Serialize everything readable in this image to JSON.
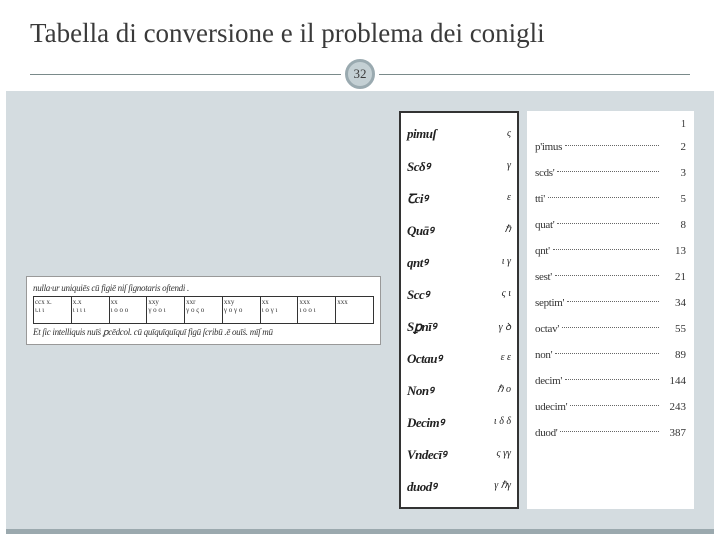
{
  "title": "Tabella di conversione e il problema dei conigli",
  "page_number": "32",
  "manuscript_table": {
    "top_text": "nulla·ur uniquiēs cū figiē niſ ſignotaris oſtendi .",
    "bottom_text": "Et ſic intelliquis nuīṡ ꝑcēdcol. cū quīquīquīquī figū ſcribū .ē ouīṡ. mīſ mū",
    "cells_top": [
      "ccx x.",
      "x.x",
      "xx",
      "xxy",
      "xxr",
      "xxy",
      "xx",
      "xxx",
      "xxx"
    ],
    "cells_bottom": [
      "ι.ι ι",
      "ι ι ι ι",
      "ι o o o",
      "γ ο ο ι",
      "γ ο ς ο",
      "γ ο γ ο",
      "ι ο γ ι",
      "ι ο ο ι"
    ]
  },
  "chart_data": {
    "type": "table",
    "title": "Fibonacci rabbit problem sequence",
    "columns": [
      "ordinal_manuscript",
      "ordinal_printed",
      "value"
    ],
    "rows": [
      {
        "ordinal_manuscript": "pimuſ",
        "ordinal_printed": "p'imus",
        "value": 2,
        "manu_num": "ς"
      },
      {
        "ordinal_manuscript": "Scδꝰ",
        "ordinal_printed": "scds'",
        "value": 3,
        "manu_num": "γ"
      },
      {
        "ordinal_manuscript": "Ꞇciꝰ",
        "ordinal_printed": "tti'",
        "value": 5,
        "manu_num": "ε"
      },
      {
        "ordinal_manuscript": "Quāꝰ",
        "ordinal_printed": "quat'",
        "value": 8,
        "manu_num": "ℏ"
      },
      {
        "ordinal_manuscript": "qntꝰ",
        "ordinal_printed": "qnt'",
        "value": 13,
        "manu_num": "ι γ"
      },
      {
        "ordinal_manuscript": "Sccꝰ",
        "ordinal_printed": "sest'",
        "value": 21,
        "manu_num": "ς ι"
      },
      {
        "ordinal_manuscript": "Sꝑnīꝰ",
        "ordinal_printed": "septim'",
        "value": 34,
        "manu_num": "γ ꝺ"
      },
      {
        "ordinal_manuscript": "Octauꝰ",
        "ordinal_printed": "octav'",
        "value": 55,
        "manu_num": "ε ε"
      },
      {
        "ordinal_manuscript": "Nonꝰ",
        "ordinal_printed": "non'",
        "value": 89,
        "manu_num": "ℏ ο"
      },
      {
        "ordinal_manuscript": "Decimꝰ",
        "ordinal_printed": "decim'",
        "value": 144,
        "manu_num": "ι δ δ"
      },
      {
        "ordinal_manuscript": "Vndecīꝰ",
        "ordinal_printed": "udecim'",
        "value": 243,
        "manu_num": "ς γγ"
      },
      {
        "ordinal_manuscript": "duodꝰ",
        "ordinal_printed": "duod'",
        "value": 387,
        "manu_num": "γ ℏγ"
      }
    ],
    "header_value": "1"
  }
}
